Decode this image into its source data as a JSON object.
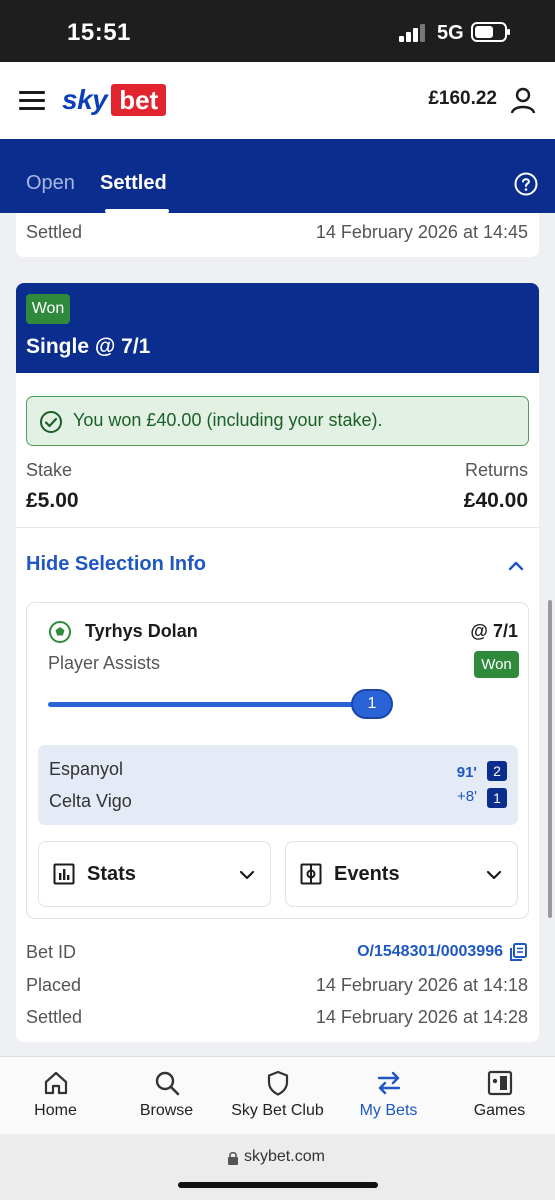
{
  "status_bar": {
    "time": "15:51",
    "network": "5G"
  },
  "header": {
    "balance": "£160.22"
  },
  "tabs": {
    "open": "Open",
    "settled": "Settled"
  },
  "previous_bet": {
    "settled_label": "Settled",
    "settled_value": "14 February 2026 at 14:45"
  },
  "bet": {
    "status": "Won",
    "title": "Single @ 7/1",
    "win_message": "You won £40.00 (including your stake).",
    "stake_label": "Stake",
    "stake_value": "£5.00",
    "returns_label": "Returns",
    "returns_value": "£40.00",
    "toggle_label": "Hide Selection Info",
    "selection": {
      "player": "Tyrhys Dolan",
      "odds": "@ 7/1",
      "market": "Player Assists",
      "status": "Won",
      "progress_value": "1",
      "progress_fraction": 1.0,
      "home_team": "Espanyol",
      "away_team": "Celta Vigo",
      "minute": "91'",
      "added_time": "+8'",
      "home_score": "2",
      "away_score": "1",
      "stats_label": "Stats",
      "events_label": "Events"
    },
    "bet_id_label": "Bet ID",
    "bet_id_value": "O/1548301/0003996",
    "placed_label": "Placed",
    "placed_value": "14 February 2026 at 14:18",
    "settled_label": "Settled",
    "settled_value": "14 February 2026 at 14:28"
  },
  "bottom_nav": [
    {
      "label": "Home",
      "icon": "home-icon"
    },
    {
      "label": "Browse",
      "icon": "search-icon"
    },
    {
      "label": "Sky Bet Club",
      "icon": "shield-icon"
    },
    {
      "label": "My Bets",
      "icon": "swap-arrows-icon"
    },
    {
      "label": "Games",
      "icon": "cards-icon"
    }
  ],
  "url": "skybet.com",
  "colors": {
    "brand_blue": "#0b2d8e",
    "accent_blue": "#1f57c3",
    "win_green": "#2f8a3c",
    "logo_red": "#e1252f"
  }
}
